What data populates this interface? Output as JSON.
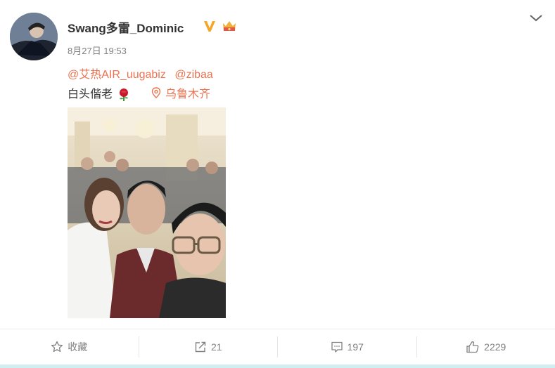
{
  "post": {
    "username": "Swang多雷_Dominic",
    "timestamp": "8月27日 19:53",
    "mentions": [
      "@艾热AIR_uugabiz",
      "@zibaa"
    ],
    "text": "白头偕老",
    "location": "乌鲁木齐",
    "image_description": "wedding selfie photo"
  },
  "actions": {
    "favorite_label": "收藏",
    "repost_count": "21",
    "comment_count": "197",
    "like_count": "2229"
  },
  "colors": {
    "link": "#eb7350",
    "verified": "#f5a623",
    "muted": "#808080"
  },
  "icons": [
    "chevron-down-icon",
    "verified-icon",
    "crown-icon",
    "rose-emoji",
    "location-pin-icon",
    "star-icon",
    "repost-icon",
    "comment-icon",
    "thumbs-up-icon"
  ]
}
